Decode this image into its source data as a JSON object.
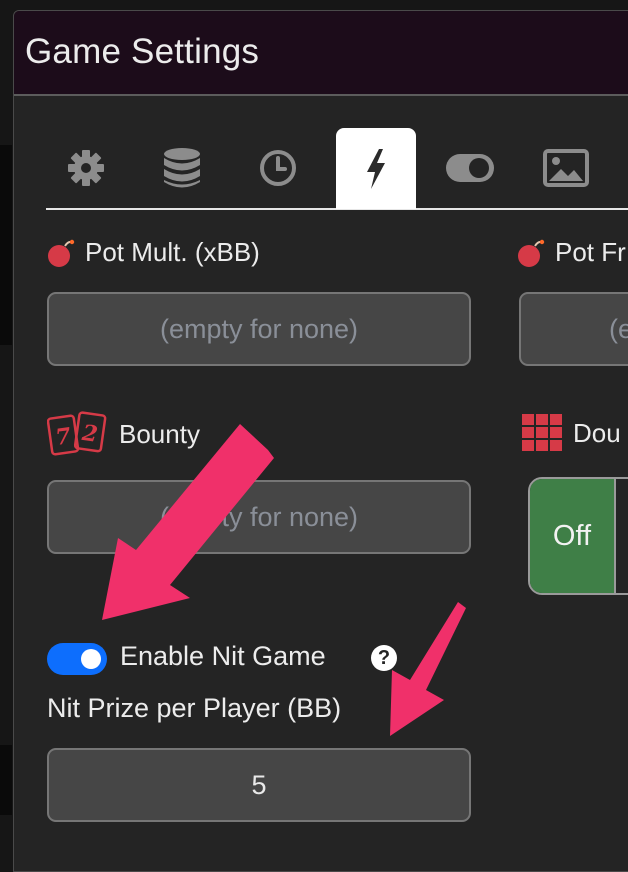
{
  "modal": {
    "title": "Game Settings"
  },
  "tabs": [
    {
      "icon": "gear-icon",
      "active": false
    },
    {
      "icon": "database-icon",
      "active": false
    },
    {
      "icon": "clock-icon",
      "active": false
    },
    {
      "icon": "lightning-bolt-icon",
      "active": true
    },
    {
      "icon": "toggle-switch-icon",
      "active": false
    },
    {
      "icon": "image-icon",
      "active": false
    }
  ],
  "fields": {
    "pot_mult": {
      "label": "Pot Mult. (xBB)",
      "placeholder": "(empty for none)",
      "value": ""
    },
    "pot_fr": {
      "label": "Pot Fr",
      "placeholder": "(e",
      "value": ""
    },
    "bounty": {
      "label": "Bounty",
      "placeholder": "(empty for none)",
      "value": "",
      "icon_text_1": "7",
      "icon_text_2": "2"
    },
    "dou": {
      "label": "Dou",
      "option_off": "Off"
    },
    "nit_game": {
      "toggle_label": "Enable Nit Game",
      "enabled": true,
      "help": "?"
    },
    "nit_prize": {
      "label": "Nit Prize per Player (BB)",
      "value": "5"
    }
  },
  "colors": {
    "header_bg": "#1c0c1a",
    "panel_bg": "#242424",
    "toggle_on": "#0d6efd",
    "segment_active": "#3f7f47",
    "annotation_arrow": "#f0306a"
  }
}
